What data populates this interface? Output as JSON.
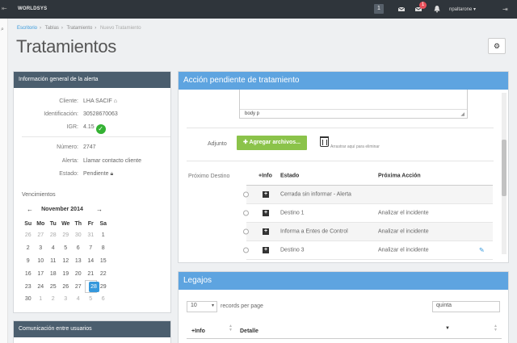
{
  "topbar": {
    "brand": "WORLDSYS",
    "back_glyph": "⇤",
    "square_glyph": "1",
    "mail_badge": "1",
    "user": "npaltarone",
    "icons": [
      "home-icon",
      "envelope-icon",
      "bell-icon",
      "burger-icon"
    ]
  },
  "breadcrumb": [
    "Escritorio",
    "Tablas",
    "Tratamiento",
    "Nuevo Tratamiento"
  ],
  "page_title": "Tratamientos",
  "left_panel": {
    "header": "Información general de la alerta",
    "fields": [
      {
        "label": "Cliente:",
        "value": "LHA SACIF"
      },
      {
        "label": "Identificación:",
        "value": "30528670063"
      },
      {
        "label": "IGR:",
        "value": "4.15"
      },
      {
        "label": "Número:",
        "value": "2747"
      },
      {
        "label": "Alerta:",
        "value": "Llamar contacto cliente"
      },
      {
        "label": "Estado:",
        "value": "Pendiente"
      }
    ],
    "vencimientos": "Vencimientos",
    "calendar": {
      "month": "November 2014",
      "prev": "←",
      "next": "→",
      "days": [
        "Su",
        "Mo",
        "Tu",
        "We",
        "Th",
        "Fr",
        "Sa"
      ],
      "weeks": [
        [
          "26",
          "27",
          "28",
          "29",
          "30",
          "31",
          "1"
        ],
        [
          "2",
          "3",
          "4",
          "5",
          "6",
          "7",
          "8"
        ],
        [
          "9",
          "10",
          "11",
          "12",
          "13",
          "14",
          "15"
        ],
        [
          "16",
          "17",
          "18",
          "19",
          "20",
          "21",
          "22"
        ],
        [
          "23",
          "24",
          "25",
          "26",
          "27",
          "28",
          "29"
        ],
        [
          "30",
          "1",
          "2",
          "3",
          "4",
          "5",
          "6"
        ]
      ],
      "selected": "28"
    }
  },
  "left_panel2": {
    "header": "Comunicación entre usuarios"
  },
  "right_panel": {
    "header": "Acción pendiente de tratamiento",
    "editor_footer": "body  p",
    "adjunto_label": "Adjunto",
    "add_files_button": "✚ Agregar archivos...",
    "drop_hint": "Arrastrar aquí para eliminar",
    "proximo_label": "Próximo Destino",
    "table": {
      "headers": [
        "+Info",
        "Estado",
        "Próxima Acción"
      ],
      "rows": [
        {
          "estado": "Cerrada sin informar - Alerta",
          "accion": ""
        },
        {
          "estado": "Destino 1",
          "accion": "Analizar el incidente"
        },
        {
          "estado": "Informa a Entes de Control",
          "accion": "Analizar el incidente"
        },
        {
          "estado": "Destino 3",
          "accion": "Analizar el incidente"
        }
      ]
    }
  },
  "legajos_panel": {
    "header": "Legajos",
    "per_page_value": "10",
    "per_page_label": "records per page",
    "search_value": "quinta",
    "columns": [
      "+Info",
      "Detalle"
    ]
  }
}
